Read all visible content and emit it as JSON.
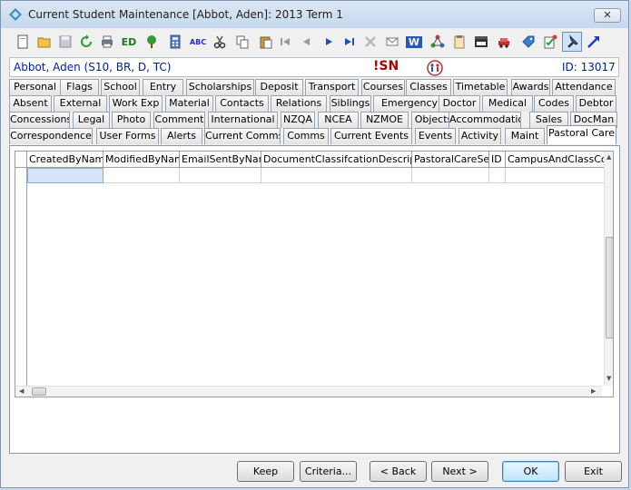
{
  "window": {
    "title": "Current Student Maintenance  [Abbot, Aden]:  2013 Term 1",
    "close_glyph": "✕"
  },
  "toolbar": {
    "buttons": [
      {
        "name": "new-icon"
      },
      {
        "name": "open-icon"
      },
      {
        "name": "save-icon"
      },
      {
        "name": "refresh-icon"
      },
      {
        "name": "print-icon"
      },
      {
        "name": "edit-icon",
        "text": "ED"
      },
      {
        "name": "tree-icon"
      },
      {
        "name": "calculator-icon"
      },
      {
        "name": "spellcheck-icon",
        "text": "ABC"
      },
      {
        "name": "cut-icon"
      },
      {
        "name": "copy-icon"
      },
      {
        "name": "paste-icon"
      },
      {
        "name": "first-record-icon"
      },
      {
        "name": "previous-record-icon"
      },
      {
        "name": "next-record-icon"
      },
      {
        "name": "last-record-icon"
      },
      {
        "name": "delete-icon"
      },
      {
        "name": "email-icon"
      },
      {
        "name": "word-icon",
        "text": "W"
      },
      {
        "name": "network-icon"
      },
      {
        "name": "clipboard-icon"
      },
      {
        "name": "film-icon"
      },
      {
        "name": "car-icon"
      },
      {
        "name": "tag-icon"
      },
      {
        "name": "edit-check-icon"
      },
      {
        "name": "pin-icon"
      },
      {
        "name": "arrow-icon"
      }
    ]
  },
  "student": {
    "name": "Abbot, Aden (S10, BR, D, TC)",
    "flag": "!SN",
    "id_label": "ID: 13017"
  },
  "tabs": {
    "rows": [
      [
        "Personal",
        "Flags",
        "School",
        "Entry",
        "Scholarships",
        "Deposit",
        "Transport",
        "Courses",
        "Classes",
        "Timetable",
        "Awards",
        "Attendance"
      ],
      [
        "Absent",
        "External",
        "Work Exp",
        "Material",
        "Contacts",
        "Relations",
        "Siblings",
        "Emergency",
        "Doctor",
        "Medical",
        "Codes",
        "Debtor"
      ],
      [
        "Concessions",
        "Legal",
        "Photo",
        "Comment",
        "International",
        "NZQA",
        "NCEA",
        "NZMOE",
        "Objects",
        "Accommodation",
        "Sales",
        "DocMan"
      ],
      [
        "Correspondence",
        "User Forms",
        "Alerts",
        "Current Comms",
        "Comms",
        "Current Events",
        "Events",
        "Activity",
        "Maint",
        "Pastoral Care"
      ]
    ],
    "active": "Pastoral Care"
  },
  "grid": {
    "columns": [
      "CreatedByName",
      "ModifiedByName",
      "EmailSentByName",
      "DocumentClassifcationDescription",
      "PastoralCareSeq",
      "ID",
      "CampusAndClassCode"
    ]
  },
  "buttons": {
    "keep": "Keep",
    "criteria": "Criteria...",
    "back": "< Back",
    "next": "Next >",
    "ok": "OK",
    "exit": "Exit"
  }
}
